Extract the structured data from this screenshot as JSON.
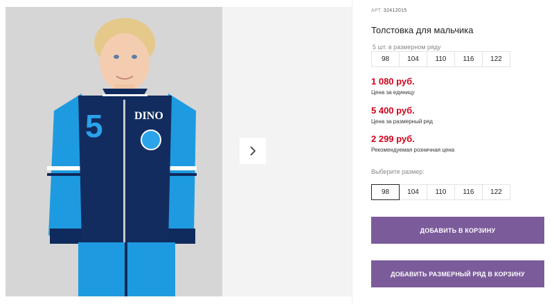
{
  "product": {
    "art_label": "АРТ.",
    "art_number": "32412015",
    "title": "Толстовка для мальчика",
    "pack_label": "5 шт. в размерном ряду",
    "pack_sizes": [
      "98",
      "104",
      "110",
      "116",
      "122"
    ],
    "prices": [
      {
        "value": "1 080 руб.",
        "note": "Цена за единицу"
      },
      {
        "value": "5 400 руб.",
        "note": "Цена за размерный ряд"
      },
      {
        "value": "2 299 руб.",
        "note": "Рекомендуемая розничная цена"
      }
    ],
    "choose_size_label": "Выберите размер:",
    "sizes": [
      "98",
      "104",
      "110",
      "116",
      "122"
    ],
    "selected_size": "98"
  },
  "buttons": {
    "add_to_cart": "ДОБАВИТЬ В КОРЗИНУ",
    "add_pack_to_cart": "ДОБАВИТЬ РАЗМЕРНЫЙ РЯД В КОРЗИНУ"
  },
  "gallery": {
    "next_icon": "chevron-right-icon"
  },
  "colors": {
    "price": "#d0021b",
    "button": "#7b5b9a",
    "photo_bg": "#d7d7d7"
  }
}
